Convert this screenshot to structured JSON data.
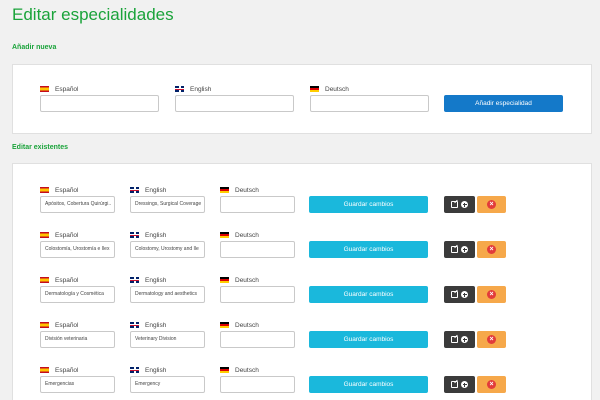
{
  "page": {
    "title": "Editar especialidades",
    "add_section_title": "Añadir nueva",
    "edit_section_title": "Editar existentes"
  },
  "languages": {
    "es": "Español",
    "en": "English",
    "de": "Deutsch"
  },
  "add_form": {
    "es_value": "",
    "en_value": "",
    "de_value": "",
    "add_button_label": "Añadir especialidad"
  },
  "edit_rows": [
    {
      "es": "Apósitos, Cobertura Quirúrgi..",
      "en": "Dressings, Surgical Coverage",
      "de": ""
    },
    {
      "es": "Colostomía, Urostomía e Ilex",
      "en": "Colostomy, Urostomy and Ile",
      "de": ""
    },
    {
      "es": "Dermatología y Cosmética",
      "en": "Dermatology and aesthetics",
      "de": ""
    },
    {
      "es": "División veterinaria",
      "en": "Veterinary Division",
      "de": ""
    },
    {
      "es": "Emergencias",
      "en": "Emergency",
      "de": ""
    }
  ],
  "buttons": {
    "save_label": "Guardar cambios"
  },
  "icons": {
    "edit": "edit-icon",
    "add": "plus-circle-icon",
    "delete": "close-circle-icon"
  },
  "colors": {
    "accent_green": "#1aa33a",
    "add_button": "#1479c9",
    "save_button": "#1ab8dc",
    "dark_button": "#3b3b3b",
    "delete_button": "#f6a84a",
    "delete_icon": "#e23b3b"
  }
}
